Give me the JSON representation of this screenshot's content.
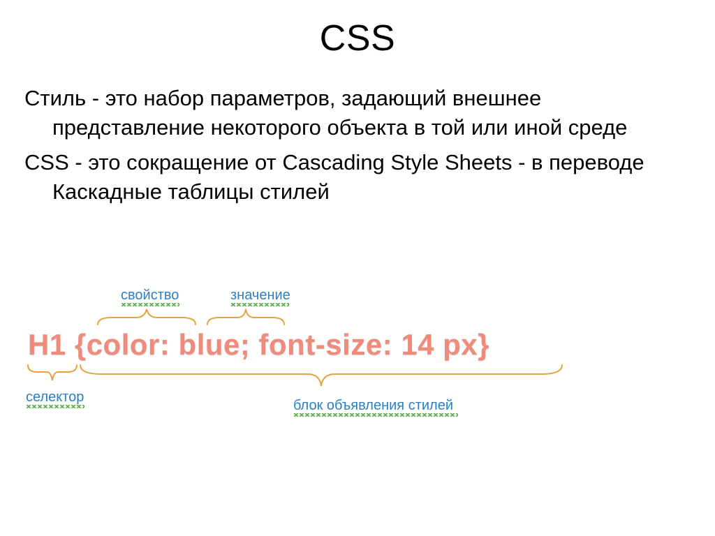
{
  "title": "CSS",
  "paragraphs": [
    "Стиль - это набор параметров, задающий внешнее представление некоторого объекта в той или иной среде",
    "CSS - это сокращение от Cascading Style Sheets - в переводе Каскадные таблицы стилей"
  ],
  "diagram": {
    "code": "H1 {color: blue; font-size: 14 px}",
    "labels": {
      "selector": "селектор",
      "property": "свойство",
      "value": "значение",
      "block": "блок объявления стилей"
    }
  }
}
